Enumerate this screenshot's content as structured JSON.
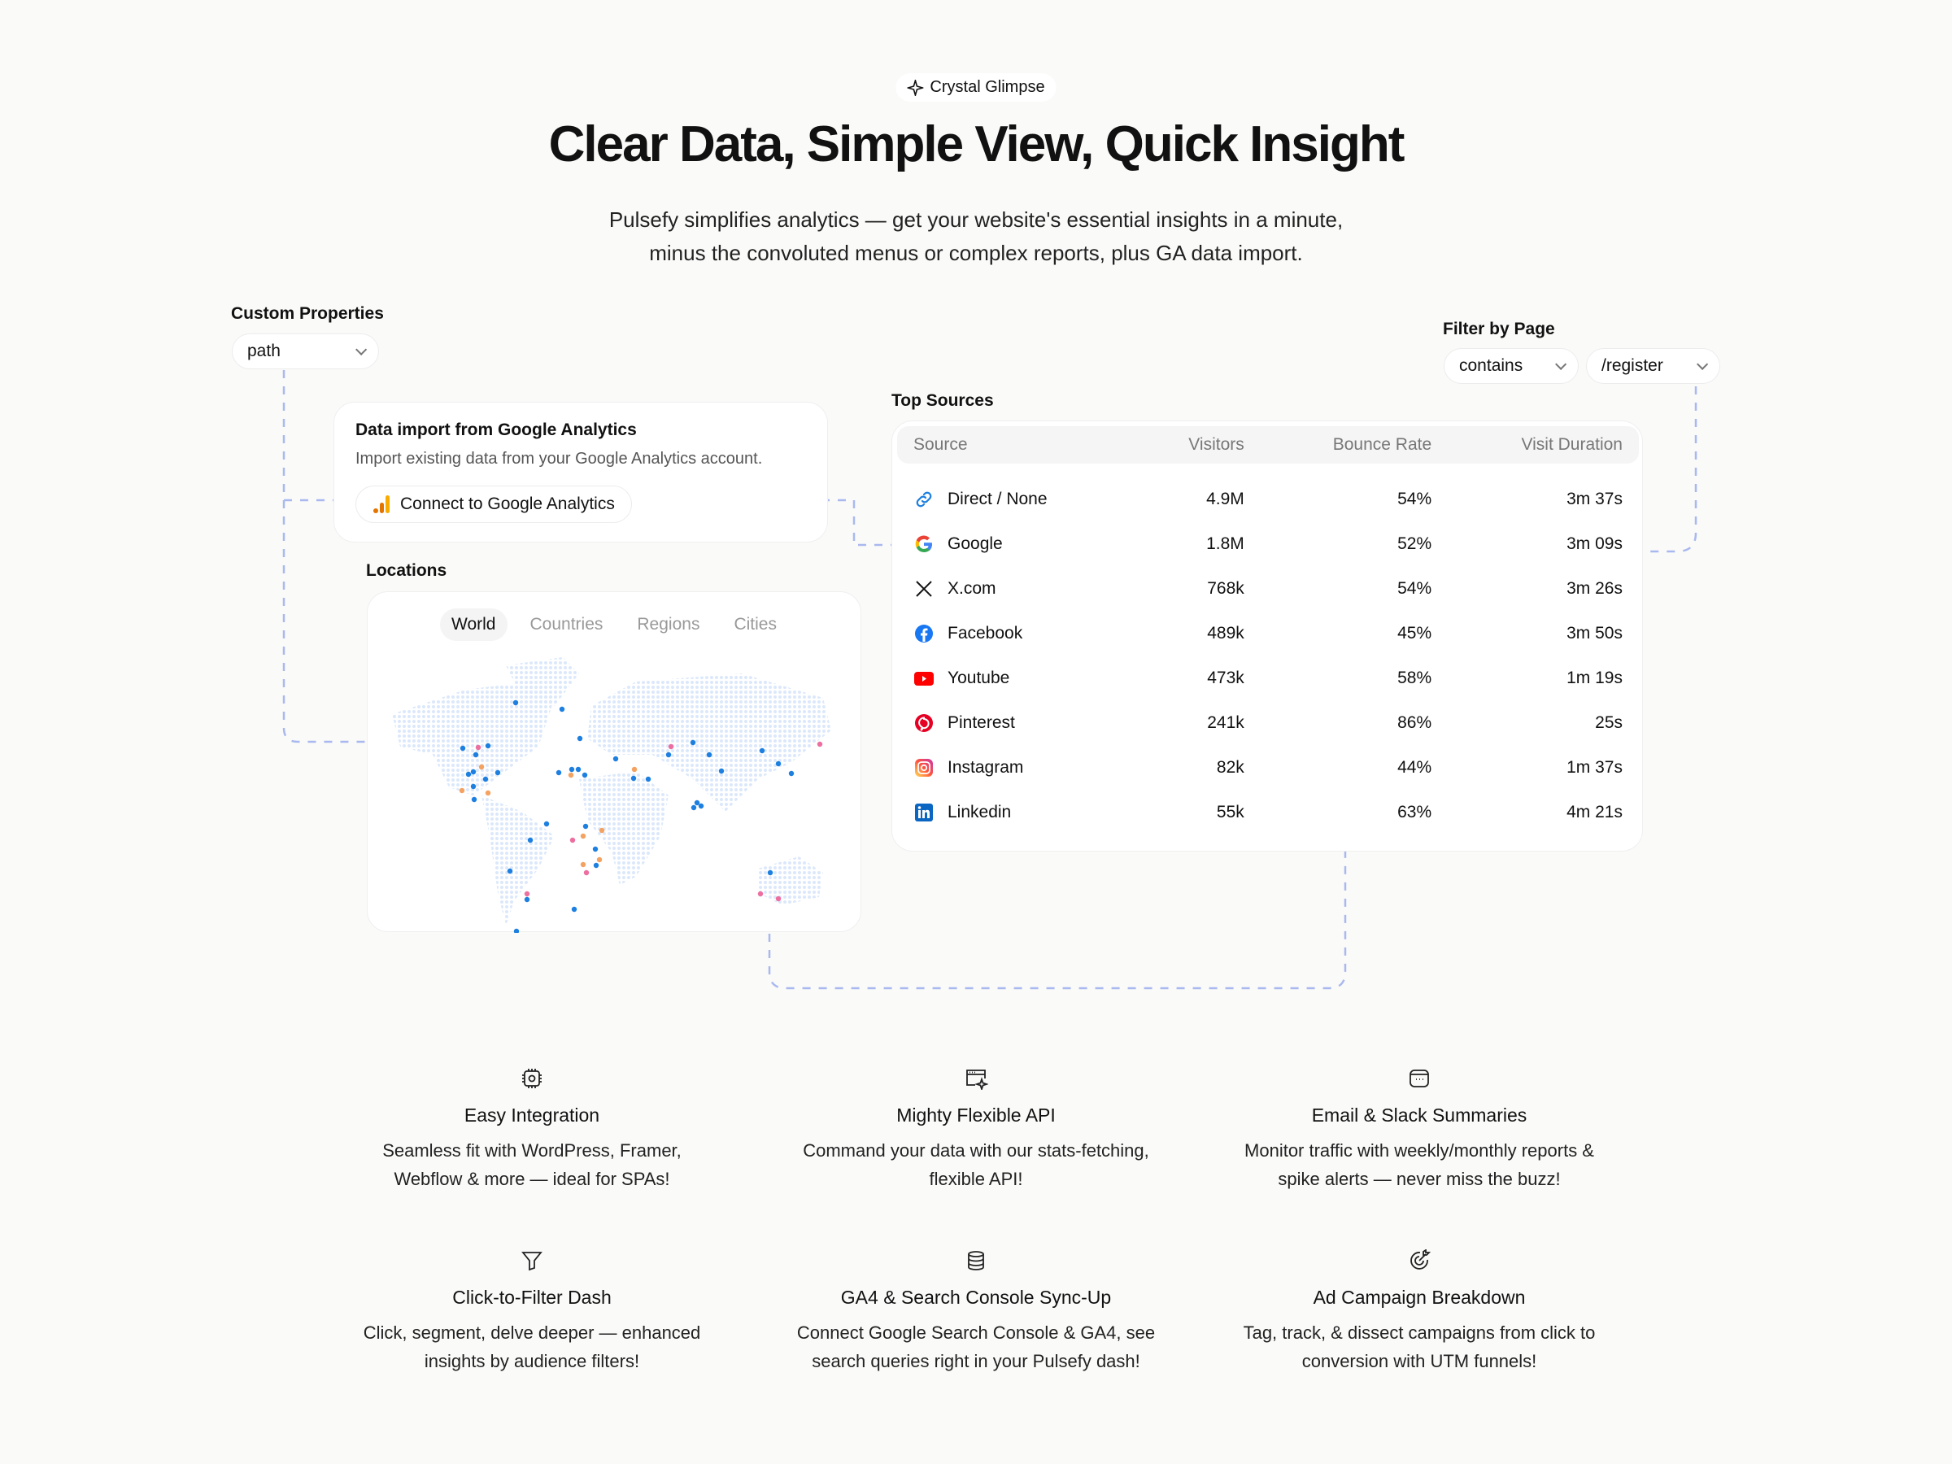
{
  "badge": {
    "icon": "sparkle-icon",
    "label": "Crystal Glimpse"
  },
  "hero": {
    "title": "Clear Data, Simple View, Quick Insight",
    "subtitle_line1": "Pulsefy simplifies analytics — get your website's essential insights in a minute,",
    "subtitle_line2": "minus the convoluted menus or complex reports, plus GA data import."
  },
  "custom_properties": {
    "label": "Custom Properties",
    "value": "path"
  },
  "filter_by_page": {
    "label": "Filter by Page",
    "operator": "contains",
    "value": "/register"
  },
  "ga_import": {
    "title": "Data import from Google Analytics",
    "description": "Import existing data from your Google Analytics account.",
    "button": "Connect to Google Analytics"
  },
  "locations": {
    "label": "Locations",
    "tabs": [
      {
        "label": "World",
        "active": true
      },
      {
        "label": "Countries",
        "active": false
      },
      {
        "label": "Regions",
        "active": false
      },
      {
        "label": "Cities",
        "active": false
      }
    ],
    "colors": {
      "land": "#dbe8fb",
      "marker": "#1d7fe0",
      "orange": "#f4a261",
      "pink": "#ec6fa0"
    }
  },
  "top_sources": {
    "label": "Top Sources",
    "columns": [
      "Source",
      "Visitors",
      "Bounce Rate",
      "Visit Duration"
    ],
    "rows": [
      {
        "icon": "link-icon",
        "source": "Direct / None",
        "visitors": "4.9M",
        "bounce": "54%",
        "duration": "3m 37s"
      },
      {
        "icon": "google-icon",
        "source": "Google",
        "visitors": "1.8M",
        "bounce": "52%",
        "duration": "3m 09s"
      },
      {
        "icon": "x-icon",
        "source": "X.com",
        "visitors": "768k",
        "bounce": "54%",
        "duration": "3m 26s"
      },
      {
        "icon": "facebook-icon",
        "source": "Facebook",
        "visitors": "489k",
        "bounce": "45%",
        "duration": "3m 50s"
      },
      {
        "icon": "youtube-icon",
        "source": "Youtube",
        "visitors": "473k",
        "bounce": "58%",
        "duration": "1m 19s"
      },
      {
        "icon": "pinterest-icon",
        "source": "Pinterest",
        "visitors": "241k",
        "bounce": "86%",
        "duration": "25s"
      },
      {
        "icon": "instagram-icon",
        "source": "Instagram",
        "visitors": "82k",
        "bounce": "44%",
        "duration": "1m 37s"
      },
      {
        "icon": "linkedin-icon",
        "source": "Linkedin",
        "visitors": "55k",
        "bounce": "63%",
        "duration": "4m 21s"
      }
    ]
  },
  "features": [
    {
      "icon": "chip-icon",
      "title": "Easy Integration",
      "line1": "Seamless fit with WordPress, Framer,",
      "line2": "Webflow & more — ideal for SPAs!"
    },
    {
      "icon": "browser-sparkle-icon",
      "title": "Mighty Flexible API",
      "line1": "Command your data with our stats-fetching,",
      "line2": "flexible API!"
    },
    {
      "icon": "message-icon",
      "title": "Email & Slack Summaries",
      "line1": "Monitor traffic with weekly/monthly reports &",
      "line2": "spike alerts — never miss the buzz!"
    },
    {
      "icon": "filter-icon",
      "title": "Click-to-Filter Dash",
      "line1": "Click, segment, delve deeper — enhanced",
      "line2": "insights by audience filters!"
    },
    {
      "icon": "database-icon",
      "title": "GA4 & Search Console Sync-Up",
      "line1": "Connect Google Search Console & GA4, see",
      "line2": "search queries right in your Pulsefy dash!"
    },
    {
      "icon": "target-icon",
      "title": "Ad Campaign Breakdown",
      "line1": "Tag, track, & dissect campaigns from click to",
      "line2": "conversion with UTM funnels!"
    }
  ]
}
